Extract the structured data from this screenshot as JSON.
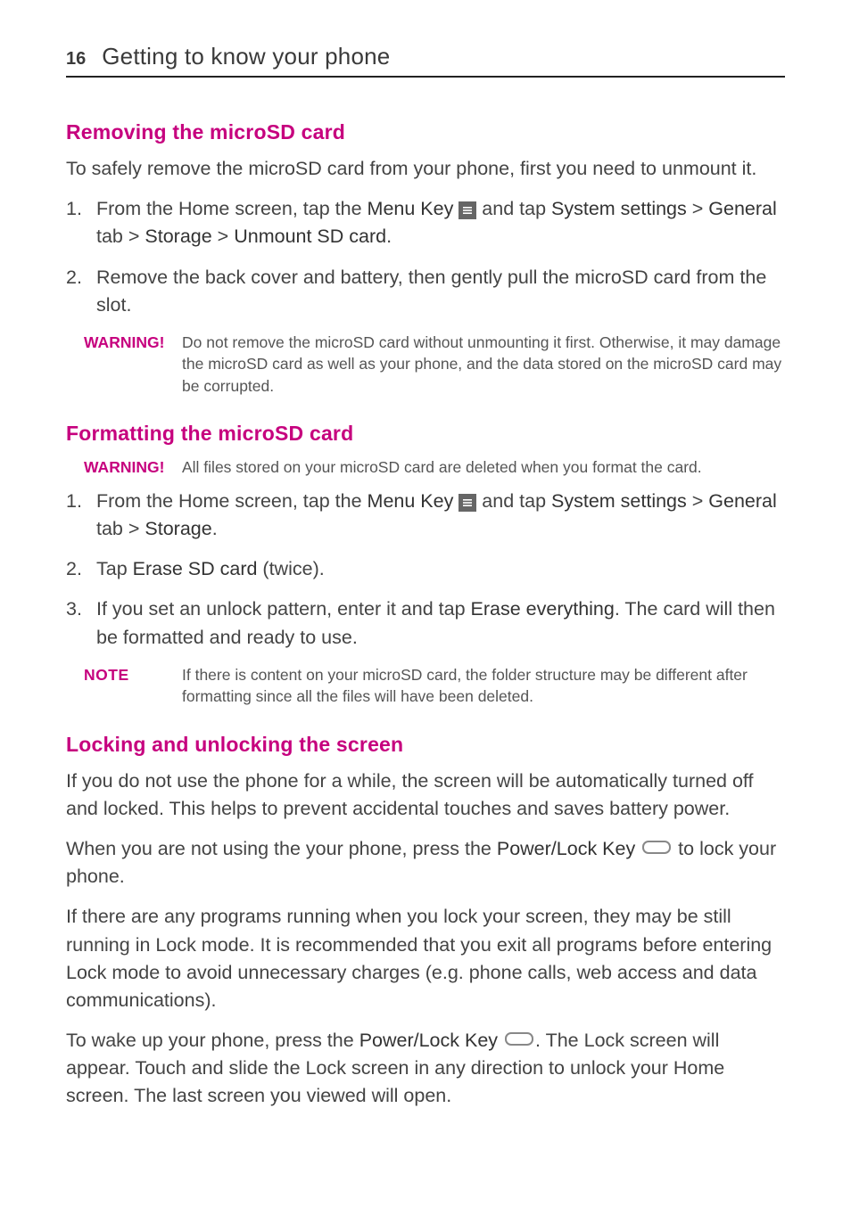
{
  "header": {
    "page_number": "16",
    "chapter_title": "Getting to know your phone"
  },
  "sections": {
    "removing": {
      "title": "Removing the microSD card",
      "intro": "To safely remove the microSD card from your phone, first you need to unmount it.",
      "step1_a": "From the Home screen, tap the ",
      "step1_menu_key": "Menu Key",
      "step1_b": " and tap ",
      "step1_sys": "System settings",
      "step1_c": " > ",
      "step1_general": "General",
      "step1_d": " tab > ",
      "step1_storage": "Storage",
      "step1_e": " > ",
      "step1_unmount": "Unmount SD card",
      "step1_f": ".",
      "step2": "Remove the back cover and battery, then gently pull the microSD card from the slot.",
      "warning_label": "WARNING!",
      "warning_text": "Do not remove the microSD card without unmounting it first. Otherwise, it may damage the microSD card as well as your phone, and the data stored on the microSD card may be corrupted."
    },
    "formatting": {
      "title": "Formatting the microSD card",
      "warning_label": "WARNING!",
      "warning_text": "All files stored on your microSD card are deleted when you format the card.",
      "step1_a": "From the Home screen, tap the ",
      "step1_menu_key": "Menu Key",
      "step1_b": " and tap ",
      "step1_sys": "System settings",
      "step1_c": " > ",
      "step1_general": "General",
      "step1_d": " tab > ",
      "step1_storage": "Storage",
      "step1_e": ".",
      "step2_a": "Tap ",
      "step2_erase": "Erase SD card",
      "step2_b": " (twice).",
      "step3_a": "If you set an unlock pattern, enter it and tap ",
      "step3_erase": "Erase everything",
      "step3_b": ". The card will then be formatted and ready to use.",
      "note_label": "NOTE",
      "note_text": "If there is content on your microSD card, the folder structure may be different after formatting since all the files will have been deleted."
    },
    "locking": {
      "title": "Locking and unlocking the screen",
      "p1": "If you do not use the phone for a while, the screen will be automatically turned off and locked. This helps to prevent accidental touches and saves battery power.",
      "p2_a": "When you are not using the your phone, press the ",
      "p2_key": "Power/Lock Key",
      "p2_b": " to lock your phone.",
      "p3": "If there are any programs running when you lock your screen, they may be still running in Lock mode. It is recommended that you exit all programs before entering Lock mode to avoid unnecessary charges (e.g. phone calls, web access and data communications).",
      "p4_a": "To wake up your phone, press the ",
      "p4_key": "Power/Lock Key",
      "p4_b": ". The Lock screen will appear. Touch and slide the Lock screen in any direction to unlock your Home screen. The last screen you viewed will open."
    }
  }
}
